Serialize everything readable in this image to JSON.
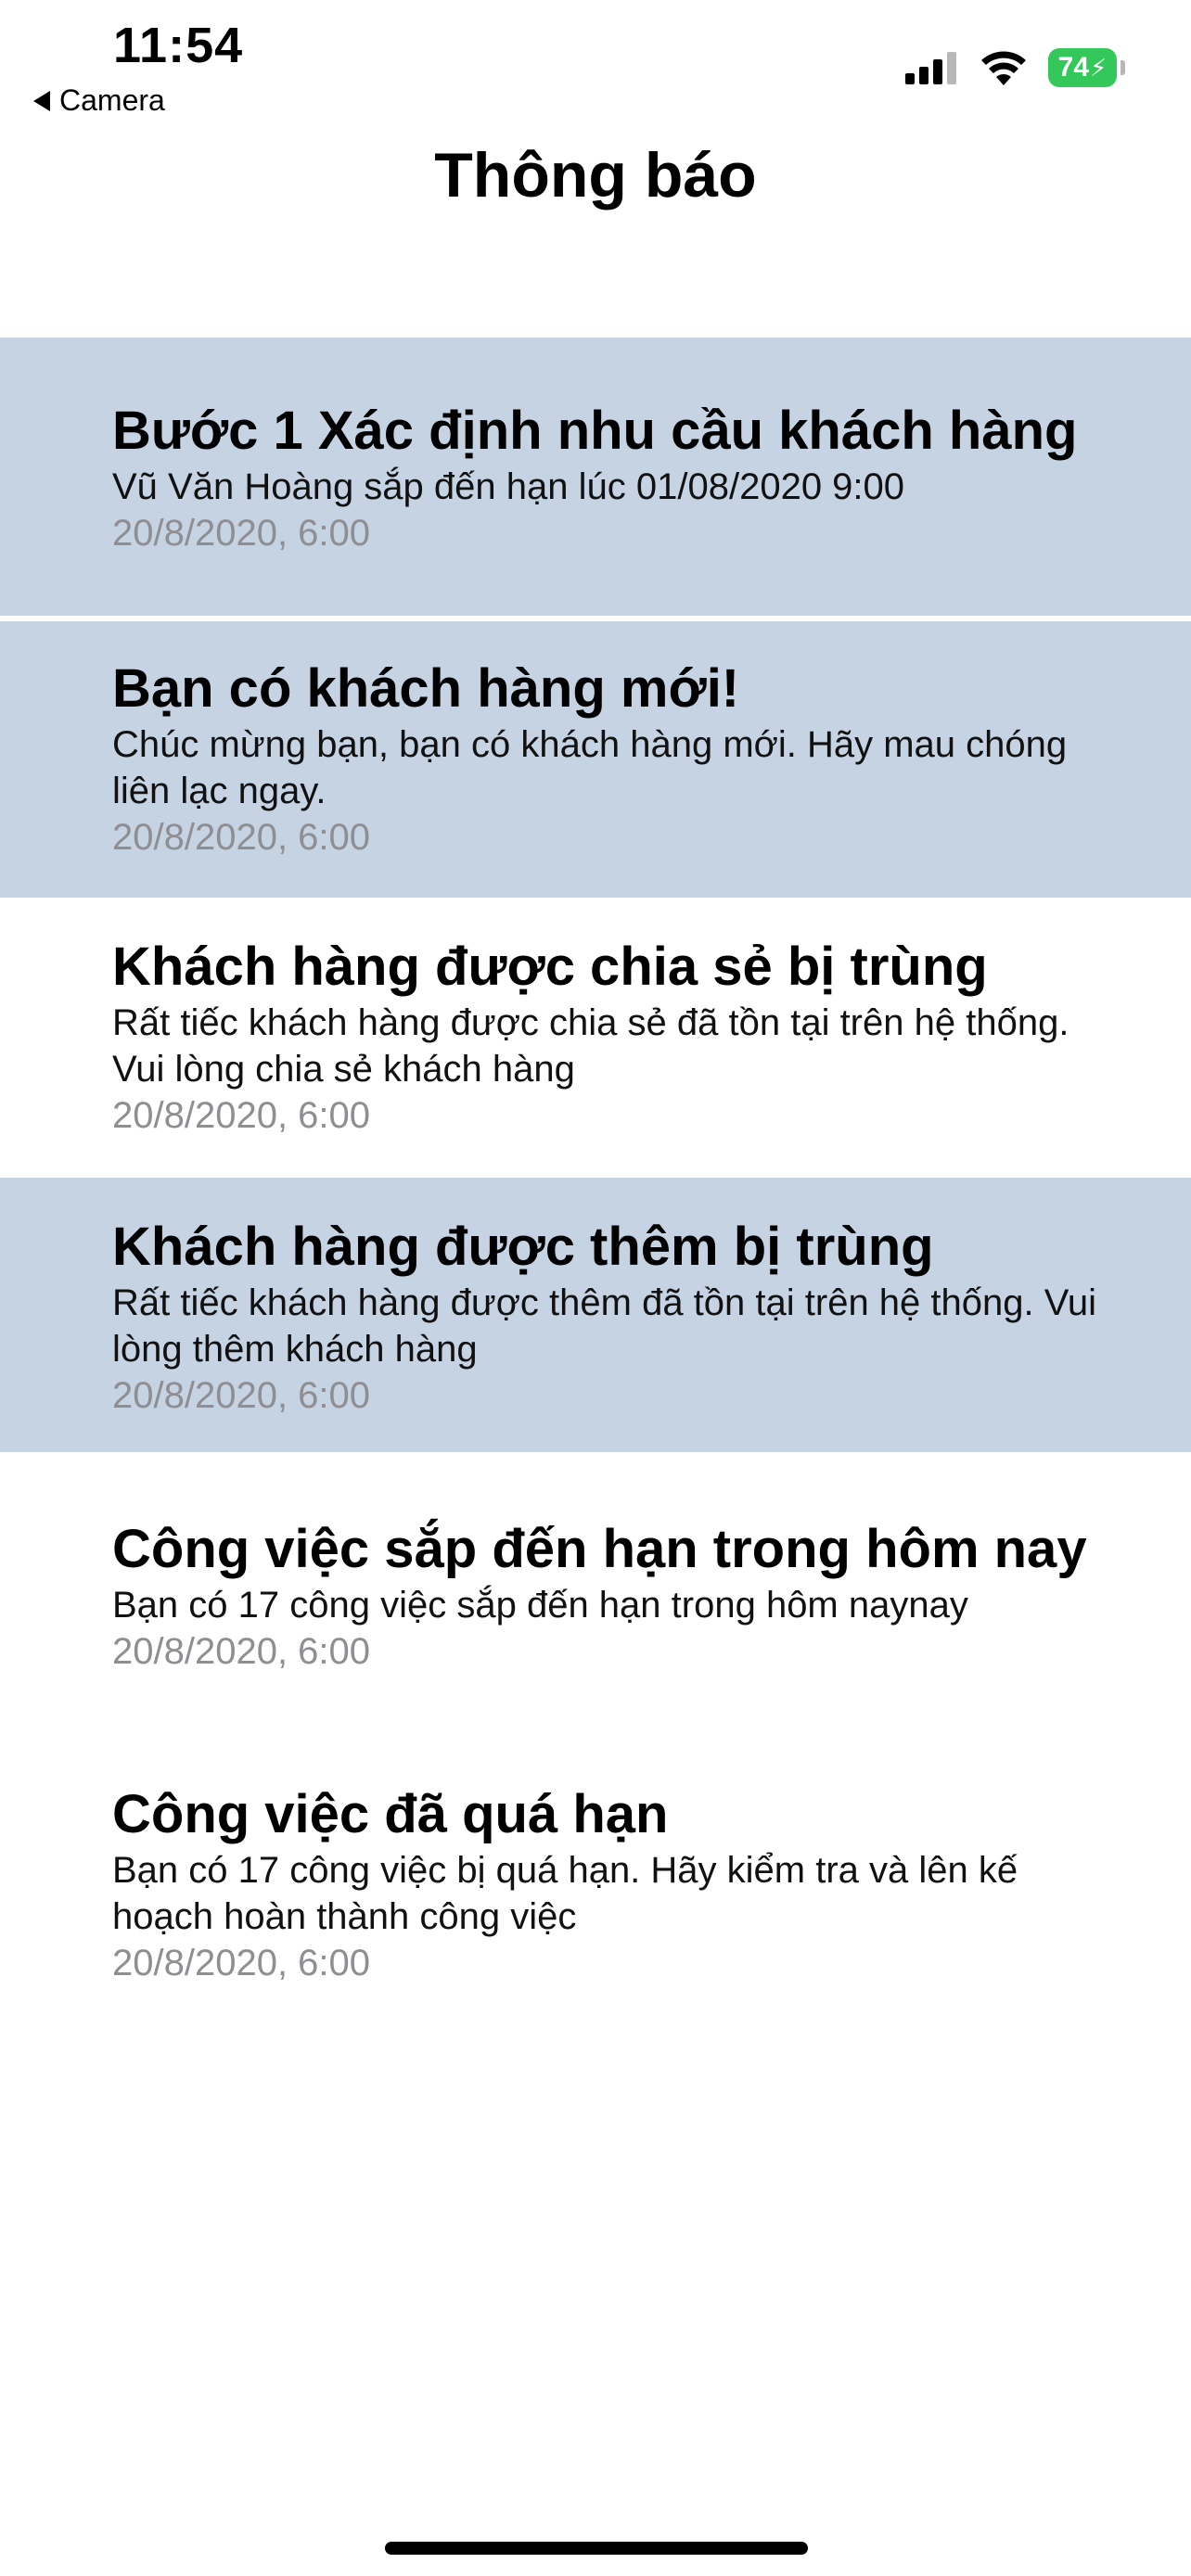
{
  "status_bar": {
    "time": "11:54",
    "back_label": "Camera",
    "battery_level": "74"
  },
  "nav": {
    "title": "Thông báo"
  },
  "notifications": [
    {
      "title": "Bước 1 Xác định nhu cầu khách hàng",
      "body": "Vũ Văn Hoàng sắp đến hạn lúc 01/08/2020 9:00",
      "time": "20/8/2020, 6:00",
      "unread": true
    },
    {
      "title": "Bạn có khách hàng mới!",
      "body": "Chúc mừng bạn, bạn có khách hàng mới. Hãy mau chóng liên lạc ngay.",
      "time": "20/8/2020, 6:00",
      "unread": true
    },
    {
      "title": "Khách hàng được chia sẻ bị trùng",
      "body": "Rất tiếc khách hàng được chia sẻ đã tồn tại trên hệ thống. Vui lòng chia sẻ khách hàng",
      "time": "20/8/2020, 6:00",
      "unread": false
    },
    {
      "title": "Khách hàng được thêm bị trùng",
      "body": "Rất tiếc khách hàng được thêm đã tồn tại trên hệ thống. Vui lòng thêm khách hàng",
      "time": "20/8/2020, 6:00",
      "unread": true
    },
    {
      "title": "Công việc sắp đến hạn trong hôm nay",
      "body": "Bạn có 17 công việc sắp đến hạn trong hôm naynay",
      "time": "20/8/2020, 6:00",
      "unread": false
    },
    {
      "title": "Công việc đã quá hạn",
      "body": "Bạn có 17 công việc bị quá hạn. Hãy kiểm tra và lên kế hoạch hoàn thành công việc",
      "time": "20/8/2020, 6:00",
      "unread": false
    }
  ],
  "colors": {
    "unread_background": "#c5d3e3",
    "timestamp": "#8e8e93",
    "battery": "#34c759"
  }
}
